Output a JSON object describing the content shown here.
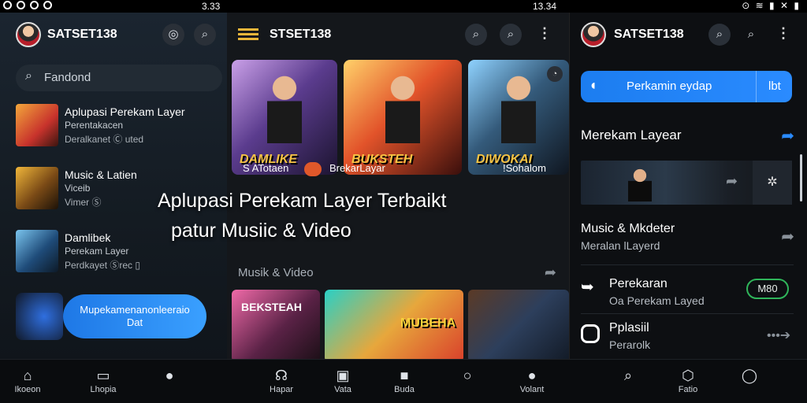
{
  "status": {
    "time_left": "3.33",
    "time_right": "13.34"
  },
  "left": {
    "brand": "SATSET138",
    "search_placeholder": "Fandond",
    "items": [
      {
        "title": "Aplupasi Perekam Layer",
        "sub1": "Perentakacen",
        "sub2": "Deralkanet  Ⓒ uted"
      },
      {
        "title": "Music & Latien",
        "sub1": "Viceib",
        "sub2": "Vimer  Ⓢ"
      },
      {
        "title": "Damlibek",
        "sub1": "Perekam Layer",
        "sub2": "Perdkayet  Ⓢrec  ▯"
      }
    ],
    "cta": "Mupekamenanonleeraio\nDat",
    "overlay_line1": "Aplupasi Perekam Layer Terbaikt",
    "overlay_line2": "patur Musiic & Video",
    "nav": [
      {
        "icon": "home-icon",
        "label": "Ikoeon"
      },
      {
        "icon": "book-icon",
        "label": "Lhopia"
      },
      {
        "icon": "person-icon",
        "label": ""
      }
    ]
  },
  "middle": {
    "brand": "STSET138",
    "cards": [
      "DAMLIKE",
      "BUKSTEH",
      "DIWOKAI"
    ],
    "caption_left": "S ATotaen",
    "caption_mid": "BrekarLayar",
    "caption_right": "!Sohalom",
    "section": "Musik & Video",
    "media_labels": [
      "BEKSTEAH",
      "MUBEHA",
      ""
    ],
    "nav": [
      {
        "icon": "headset-icon",
        "label": "Hapar"
      },
      {
        "icon": "badge-icon",
        "label": "Vata"
      },
      {
        "icon": "square-icon",
        "label": "Buda"
      },
      {
        "icon": "circle-icon",
        "label": ""
      },
      {
        "icon": "user-icon",
        "label": "Volant"
      }
    ]
  },
  "right": {
    "brand": "SATSET138",
    "blue_label": "Perkamin eydap",
    "blue_right": "lbt",
    "section_title": "Merekam Layear",
    "row1": {
      "title": "Music & Mkdeter",
      "sub": "Meralan lLayerd"
    },
    "row2": {
      "title": "Perekaran",
      "sub": "Oa Perekam Layed",
      "pill": "M80"
    },
    "row3": {
      "title": "Pplasiil",
      "sub": "Perarolk"
    },
    "nav": [
      {
        "icon": "search-icon",
        "label": ""
      },
      {
        "icon": "shield-icon",
        "label": "Fatio"
      },
      {
        "icon": "chat-icon",
        "label": ""
      }
    ]
  }
}
